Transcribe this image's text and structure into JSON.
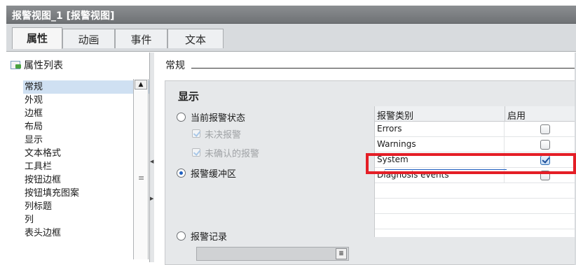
{
  "window": {
    "title": "报警视图_1 [报警视图]"
  },
  "tabs": [
    {
      "label": "属性",
      "active": true
    },
    {
      "label": "动画",
      "active": false
    },
    {
      "label": "事件",
      "active": false
    },
    {
      "label": "文本",
      "active": false
    }
  ],
  "property_list": {
    "header": "属性列表",
    "items": [
      "常规",
      "外观",
      "边框",
      "布局",
      "显示",
      "文本格式",
      "工具栏",
      "按钮边框",
      "按钮填充图案",
      "列标题",
      "列",
      "表头边框"
    ],
    "selected_index": 0
  },
  "section": {
    "title": "常规"
  },
  "display_panel": {
    "title": "显示",
    "options": {
      "current_state": "当前报警状态",
      "unresolved": "未决报警",
      "unacknowledged": "未确认的报警",
      "buffer": "报警缓冲区",
      "log": "报警记录"
    },
    "selected_option": "buffer"
  },
  "alarm_class_table": {
    "headers": [
      "报警类别",
      "启用"
    ],
    "rows": [
      {
        "name": "Errors",
        "enabled": false
      },
      {
        "name": "Warnings",
        "enabled": false
      },
      {
        "name": "System",
        "enabled": true
      },
      {
        "name": "Diagnosis events",
        "enabled": false
      }
    ]
  },
  "colors": {
    "highlight": "#e41e26",
    "titlebar": "#7d8083",
    "selection": "#cfe0f2"
  }
}
